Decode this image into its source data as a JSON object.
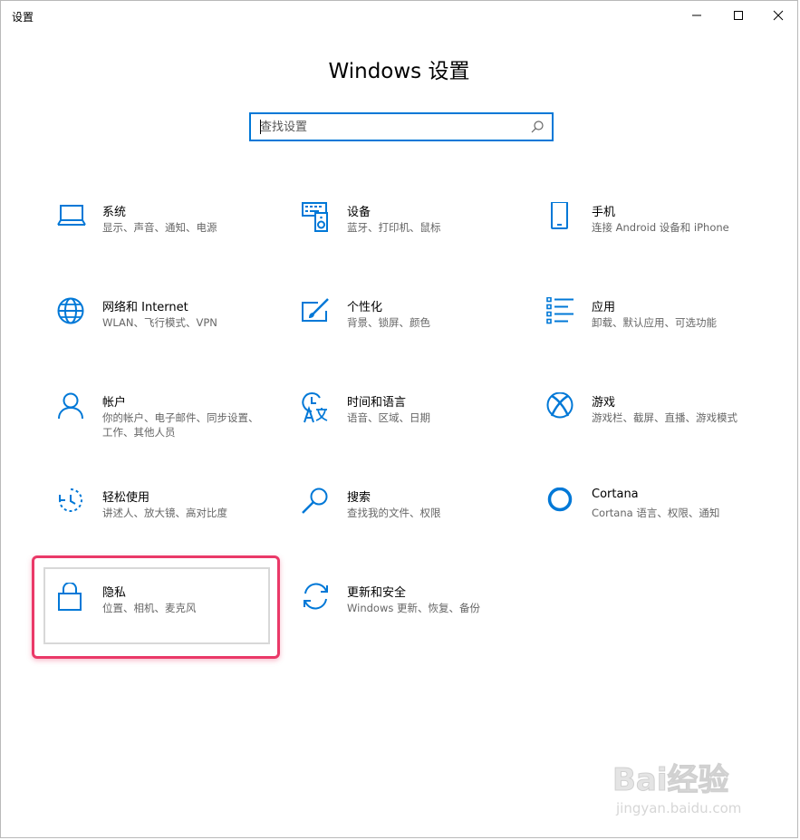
{
  "window": {
    "title": "设置",
    "minimize_glyph": "–",
    "maximize_glyph": "☐",
    "close_glyph": "✕"
  },
  "heading": "Windows 设置",
  "search": {
    "placeholder": "查找设置",
    "icon": "search-icon"
  },
  "accent_color": "#0078d7",
  "highlight_color": "#ea3968",
  "tiles": [
    {
      "name": "系统",
      "desc": "显示、声音、通知、电源",
      "icon": "laptop-icon"
    },
    {
      "name": "设备",
      "desc": "蓝牙、打印机、鼠标",
      "icon": "devices-icon"
    },
    {
      "name": "手机",
      "desc": "连接 Android 设备和 iPhone",
      "icon": "phone-icon"
    },
    {
      "name": "网络和 Internet",
      "desc": "WLAN、飞行模式、VPN",
      "icon": "globe-icon"
    },
    {
      "name": "个性化",
      "desc": "背景、锁屏、颜色",
      "icon": "paint-icon"
    },
    {
      "name": "应用",
      "desc": "卸载、默认应用、可选功能",
      "icon": "apps-list-icon"
    },
    {
      "name": "帐户",
      "desc": "你的帐户、电子邮件、同步设置、工作、其他人员",
      "icon": "person-icon"
    },
    {
      "name": "时间和语言",
      "desc": "语音、区域、日期",
      "icon": "time-language-icon"
    },
    {
      "name": "游戏",
      "desc": "游戏栏、截屏、直播、游戏模式",
      "icon": "xbox-icon"
    },
    {
      "name": "轻松使用",
      "desc": "讲述人、放大镜、高对比度",
      "icon": "ease-of-access-icon"
    },
    {
      "name": "搜索",
      "desc": "查找我的文件、权限",
      "icon": "magnifier-icon"
    },
    {
      "name": "Cortana",
      "desc": "Cortana 语言、权限、通知",
      "icon": "cortana-icon"
    },
    {
      "name": "隐私",
      "desc": "位置、相机、麦克风",
      "icon": "lock-icon"
    },
    {
      "name": "更新和安全",
      "desc": "Windows 更新、恢复、备份",
      "icon": "update-icon"
    }
  ],
  "watermark": {
    "big": "Bai经验",
    "small": "jingyan.baidu.com"
  }
}
